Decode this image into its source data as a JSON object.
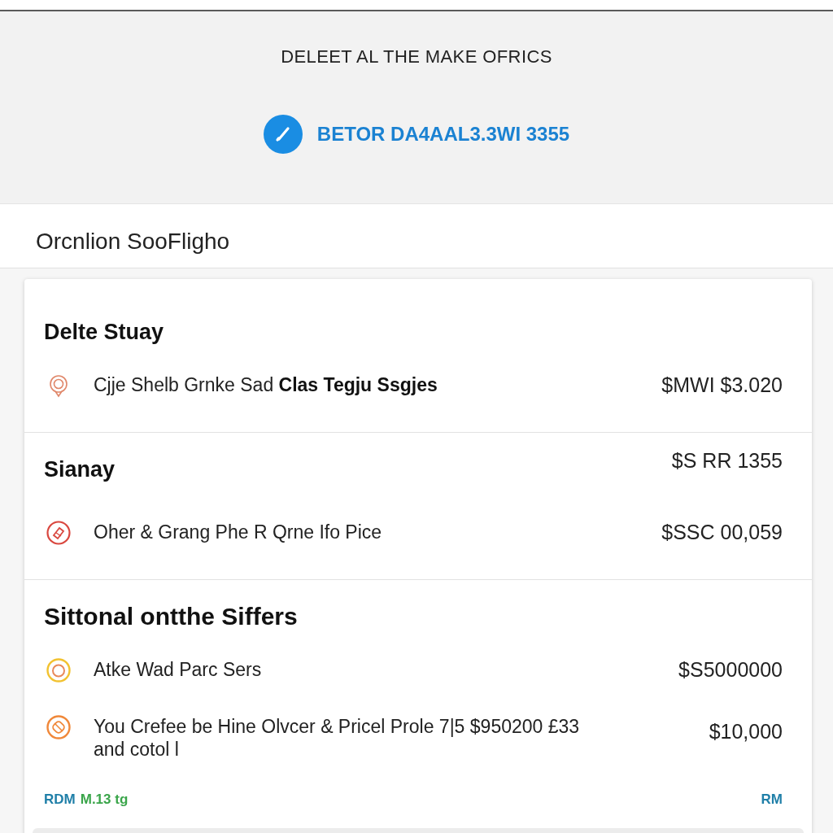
{
  "header": {
    "title": "DELEET AL THE MAKE OFRICS",
    "status": "BETOR DA4AAL3.3WI 3355"
  },
  "subheader": {
    "title": "Orcnlion SooFligho"
  },
  "sections": [
    {
      "heading": "Delte Stuay",
      "items": [
        {
          "text": "Cjje Shelb Grnke Sad **Clas Tegju Ssgjes**",
          "amount": "$MWI $3.020",
          "color": "#e0876a"
        }
      ]
    },
    {
      "heading": "Sianay",
      "amount": "$S RR 1355",
      "items": [
        {
          "text": "Oher  & Grang Phe R Qrne Ifo Pice",
          "amount": "$SSC 00,059",
          "color": "#d9473f"
        }
      ]
    },
    {
      "heading": "Sittonal  ontthe Siffers",
      "items": [
        {
          "text": "Atke Wad Parc Sers",
          "amount": "$S5000000",
          "color": "#f2c230"
        },
        {
          "text": "You Crefee be Hine Olvcer &  Pricel Prole 7|5 $950200 £33 and cotol l",
          "amount": "$10,000",
          "color": "#f0883a"
        }
      ]
    }
  ],
  "footer": {
    "left": [
      {
        "text": "RDM",
        "color": "#1f7fa8"
      },
      {
        "text": "M.13 tg",
        "color": "#3aa54a"
      }
    ],
    "right": "RM"
  }
}
